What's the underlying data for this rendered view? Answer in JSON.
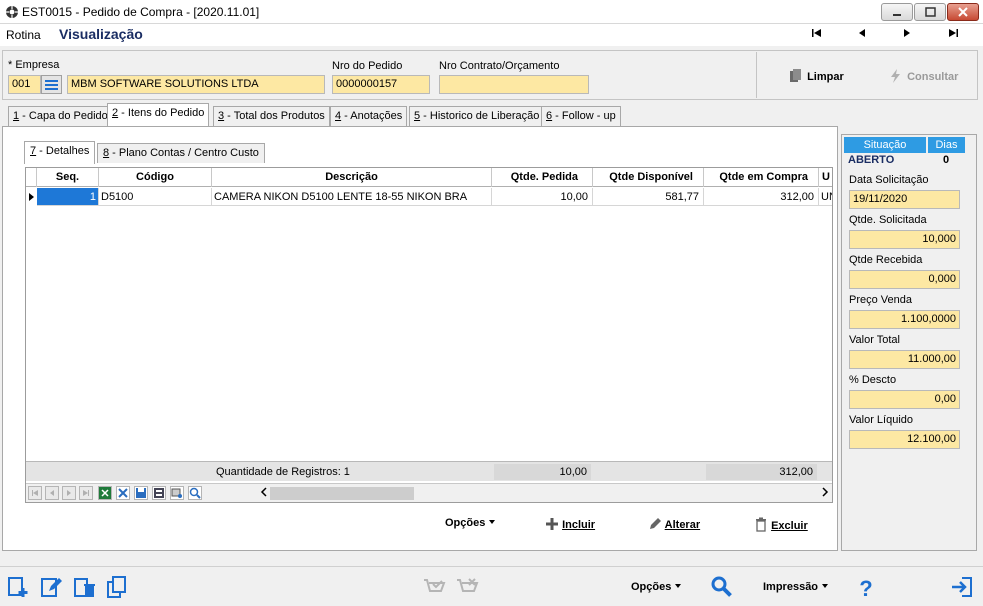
{
  "window": {
    "title": "EST0015 - Pedido de Compra - [2020.11.01]"
  },
  "menu": {
    "rotina": "Rotina",
    "mode": "Visualização"
  },
  "header": {
    "empresa_label": "* Empresa",
    "empresa_code": "001",
    "empresa_name": "MBM SOFTWARE SOLUTIONS LTDA",
    "pedido_label": "Nro do Pedido",
    "pedido_value": "0000000157",
    "contrato_label": "Nro Contrato/Orçamento",
    "contrato_value": "",
    "limpar": "Limpar",
    "consultar": "Consultar"
  },
  "tabs": [
    {
      "num": "1",
      "label": " - Capa do Pedido"
    },
    {
      "num": "2",
      "label": " - Itens do Pedido"
    },
    {
      "num": "3",
      "label": " - Total dos Produtos"
    },
    {
      "num": "4",
      "label": " - Anotações"
    },
    {
      "num": "5",
      "label": " - Historico de Liberação"
    },
    {
      "num": "6",
      "label": " - Follow - up"
    }
  ],
  "subtabs": [
    {
      "num": "7",
      "label": " - Detalhes"
    },
    {
      "num": "8",
      "label": " - Plano Contas / Centro Custo"
    }
  ],
  "grid": {
    "columns": [
      "Seq.",
      "Código",
      "Descrição",
      "Qtde. Pedida",
      "Qtde Disponível",
      "Qtde em Compra",
      "U"
    ],
    "rows": [
      {
        "seq": "1",
        "codigo": "D5100",
        "descricao": "CAMERA NIKON D5100 LENTE 18-55 NIKON BRA",
        "pedida": "10,00",
        "disponivel": "581,77",
        "compra": "312,00",
        "un": "UN"
      }
    ],
    "footer": {
      "count": "Quantidade de Registros: 1",
      "total_pedida": "10,00",
      "total_compra": "312,00"
    }
  },
  "actions": {
    "opcoes": "Opções",
    "incluir": "Incluir",
    "alterar": "Alterar",
    "excluir": "Excluir"
  },
  "side": {
    "situacao_label": "Situação",
    "dias_label": "Dias",
    "situacao_value": "ABERTO",
    "dias_value": "0",
    "fields": [
      {
        "label": "Data Solicitação",
        "value": "19/11/2020",
        "align": "left"
      },
      {
        "label": "Qtde. Solicitada",
        "value": "10,000",
        "align": "right"
      },
      {
        "label": "Qtde Recebida",
        "value": "0,000",
        "align": "right"
      },
      {
        "label": "Preço Venda",
        "value": "1.100,0000",
        "align": "right"
      },
      {
        "label": "Valor Total",
        "value": "11.000,00",
        "align": "right"
      },
      {
        "label": "% Descto",
        "value": "0,00",
        "align": "right"
      },
      {
        "label": "Valor Líquido",
        "value": "12.100,00",
        "align": "right"
      }
    ]
  },
  "bottom": {
    "opcoes": "Opções",
    "impressao": "Impressão"
  },
  "colors": {
    "accent": "#1a2d63",
    "field_bg": "#fde8a3",
    "situacao_bg": "#2e9be3",
    "icon_blue": "#1d6fd0"
  }
}
